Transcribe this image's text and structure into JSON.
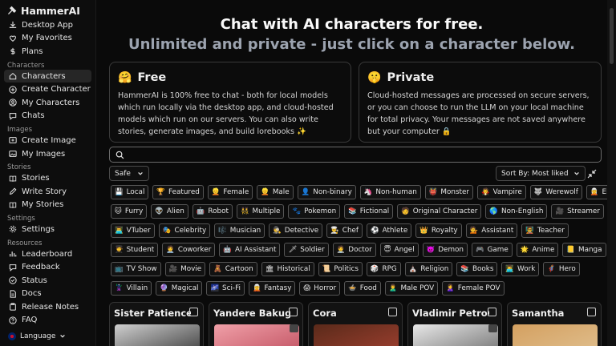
{
  "sidebar": {
    "brand": "HammerAI",
    "top_items": [
      {
        "label": "Desktop App",
        "icon": "download-icon"
      },
      {
        "label": "My Favorites",
        "icon": "heart-icon"
      },
      {
        "label": "Plans",
        "icon": "dollar-icon"
      }
    ],
    "sections": [
      {
        "title": "Characters",
        "items": [
          {
            "label": "Characters",
            "icon": "home-icon",
            "active": true
          },
          {
            "label": "Create Character",
            "icon": "plus-circle-icon"
          },
          {
            "label": "My Characters",
            "icon": "user-circle-icon"
          },
          {
            "label": "Chats",
            "icon": "chat-icon"
          }
        ]
      },
      {
        "title": "Images",
        "items": [
          {
            "label": "Create Image",
            "icon": "image-plus-icon"
          },
          {
            "label": "My Images",
            "icon": "images-icon"
          }
        ]
      },
      {
        "title": "Stories",
        "items": [
          {
            "label": "Stories",
            "icon": "book-icon"
          },
          {
            "label": "Write Story",
            "icon": "pencil-icon"
          },
          {
            "label": "My Stories",
            "icon": "book-open-icon"
          }
        ]
      },
      {
        "title": "Settings",
        "items": [
          {
            "label": "Settings",
            "icon": "gear-icon"
          }
        ]
      },
      {
        "title": "Resources",
        "items": [
          {
            "label": "Leaderboard",
            "icon": "chart-icon"
          },
          {
            "label": "Feedback",
            "icon": "message-icon"
          },
          {
            "label": "Status",
            "icon": "check-circle-icon"
          },
          {
            "label": "Docs",
            "icon": "document-icon"
          },
          {
            "label": "Release Notes",
            "icon": "clipboard-icon"
          },
          {
            "label": "FAQ",
            "icon": "question-icon"
          }
        ]
      }
    ],
    "language": "Language"
  },
  "header": {
    "title": "Chat with AI characters for free.",
    "subtitle": "Unlimited and private - just click on a character below."
  },
  "cards": {
    "free": {
      "emoji": "🤗",
      "title": "Free",
      "body": "HammerAI is 100% free to chat - both for local models which run locally via the desktop app, and cloud-hosted models which run on our servers. You can also write stories, generate images, and build lorebooks ✨"
    },
    "private": {
      "emoji": "🤫",
      "title": "Private",
      "body": "Cloud-hosted messages are processed on secure servers, or you can choose to run the LLM on your local machine for total privacy. Your messages are not saved anywhere but your computer 🔒"
    }
  },
  "search": {
    "placeholder": "",
    "value": ""
  },
  "filters": {
    "safe_label": "Safe",
    "sort_label": "Sort By: Most liked"
  },
  "tag_rows": [
    [
      {
        "icon": "💾",
        "label": "Local"
      },
      {
        "icon": "🏆",
        "label": "Featured"
      },
      {
        "icon": "👱",
        "label": "Female"
      },
      {
        "icon": "👱",
        "label": "Male"
      },
      {
        "icon": "👤",
        "label": "Non-binary"
      },
      {
        "icon": "🦄",
        "label": "Non-human"
      },
      {
        "icon": "👹",
        "label": "Monster"
      },
      {
        "icon": "🧛",
        "label": "Vampire"
      },
      {
        "icon": "🐺",
        "label": "Werewolf"
      },
      {
        "icon": "🧝",
        "label": "Elf"
      }
    ],
    [
      {
        "icon": "🐱",
        "label": "Furry"
      },
      {
        "icon": "👽",
        "label": "Alien"
      },
      {
        "icon": "🤖",
        "label": "Robot"
      },
      {
        "icon": "👯",
        "label": "Multiple"
      },
      {
        "icon": "🐾",
        "label": "Pokemon"
      },
      {
        "icon": "📚",
        "label": "Fictional"
      },
      {
        "icon": "🧑",
        "label": "Original Character"
      },
      {
        "icon": "🌎",
        "label": "Non-English"
      },
      {
        "icon": "🎥",
        "label": "Streamer"
      }
    ],
    [
      {
        "icon": "👨‍💻",
        "label": "VTuber"
      },
      {
        "icon": "🎭",
        "label": "Celebrity"
      },
      {
        "icon": "🎼",
        "label": "Musician"
      },
      {
        "icon": "🕵",
        "label": "Detective"
      },
      {
        "icon": "👨‍🍳",
        "label": "Chef"
      },
      {
        "icon": "⚽",
        "label": "Athlete"
      },
      {
        "icon": "👑",
        "label": "Royalty"
      },
      {
        "icon": "💁",
        "label": "Assistant"
      },
      {
        "icon": "🧑‍🏫",
        "label": "Teacher"
      }
    ],
    [
      {
        "icon": "🧑‍🎓",
        "label": "Student"
      },
      {
        "icon": "🧑‍💼",
        "label": "Coworker"
      },
      {
        "icon": "🤖",
        "label": "AI Assistant"
      },
      {
        "icon": "🗡",
        "label": "Soldier"
      },
      {
        "icon": "🧑‍⚕️",
        "label": "Doctor"
      },
      {
        "icon": "😇",
        "label": "Angel"
      },
      {
        "icon": "👿",
        "label": "Demon"
      },
      {
        "icon": "🎮",
        "label": "Game"
      },
      {
        "icon": "🌟",
        "label": "Anime"
      },
      {
        "icon": "📒",
        "label": "Manga"
      }
    ],
    [
      {
        "icon": "📺",
        "label": "TV Show"
      },
      {
        "icon": "🎥",
        "label": "Movie"
      },
      {
        "icon": "🧸",
        "label": "Cartoon"
      },
      {
        "icon": "🏛",
        "label": "Historical"
      },
      {
        "icon": "📜",
        "label": "Politics"
      },
      {
        "icon": "🎲",
        "label": "RPG"
      },
      {
        "icon": "⛪",
        "label": "Religion"
      },
      {
        "icon": "📚",
        "label": "Books"
      },
      {
        "icon": "👨‍💻",
        "label": "Work"
      },
      {
        "icon": "🦸",
        "label": "Hero"
      }
    ],
    [
      {
        "icon": "🦹",
        "label": "Villain"
      },
      {
        "icon": "🔮",
        "label": "Magical"
      },
      {
        "icon": "🌌",
        "label": "Sci-Fi"
      },
      {
        "icon": "🧝",
        "label": "Fantasy"
      },
      {
        "icon": "😱",
        "label": "Horror"
      },
      {
        "icon": "🍲",
        "label": "Food"
      },
      {
        "icon": "🙎‍♂️",
        "label": "Male POV"
      },
      {
        "icon": "🙎‍♀️",
        "label": "Female POV"
      }
    ]
  ],
  "characters": [
    {
      "name": "Sister Patience",
      "color_a": "#cfcfcf",
      "color_b": "#3a3a3a",
      "private": false
    },
    {
      "name": "Yandere Bakugo",
      "color_a": "#f0a0a8",
      "color_b": "#c05060",
      "private": true
    },
    {
      "name": "Cora",
      "color_a": "#5a2a1a",
      "color_b": "#a04030",
      "private": false
    },
    {
      "name": "Vladimir Petrov",
      "color_a": "#e8e8e8",
      "color_b": "#707070",
      "private": true
    },
    {
      "name": "Samantha",
      "color_a": "#d4a060",
      "color_b": "#e0c090",
      "private": false
    }
  ]
}
